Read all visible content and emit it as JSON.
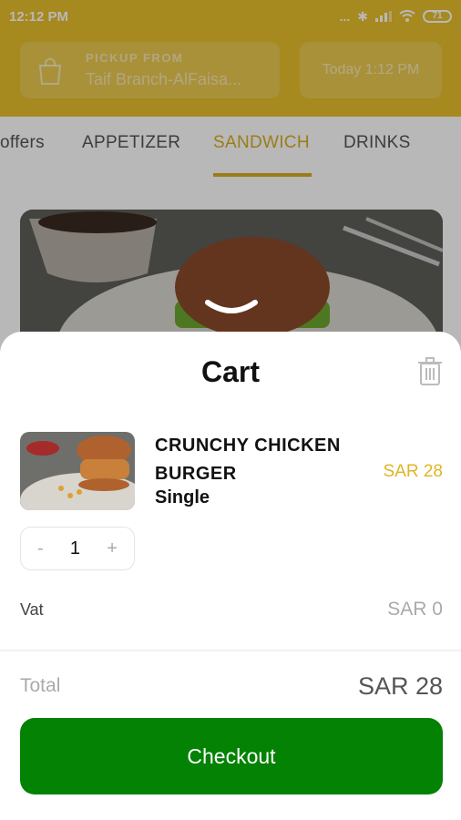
{
  "status_bar": {
    "time": "12:12 PM",
    "signal_text": "...",
    "battery": "71",
    "icons": [
      "bluetooth-icon",
      "signal-icon",
      "wifi-icon",
      "battery-icon"
    ]
  },
  "header": {
    "pickup_label": "PICKUP FROM",
    "pickup_value": "Taif Branch-AlFaisa...",
    "time_value": "Today 1:12 PM"
  },
  "categories": {
    "items": [
      "offers",
      "APPETIZER",
      "SANDWICH",
      "DRINKS"
    ],
    "active": "SANDWICH"
  },
  "cart": {
    "title": "Cart",
    "item": {
      "name": "CRUNCHY CHICKEN BURGER",
      "variant": "Single",
      "price": "SAR 28",
      "quantity": "1",
      "decrement": "-",
      "increment": "+"
    },
    "vat_label": "Vat",
    "vat_value": "SAR 0",
    "total_label": "Total",
    "total_value": "SAR 28",
    "checkout_label": "Checkout"
  },
  "colors": {
    "brand": "#e6be2b",
    "accent": "#d7ae22",
    "checkout": "#038203"
  }
}
